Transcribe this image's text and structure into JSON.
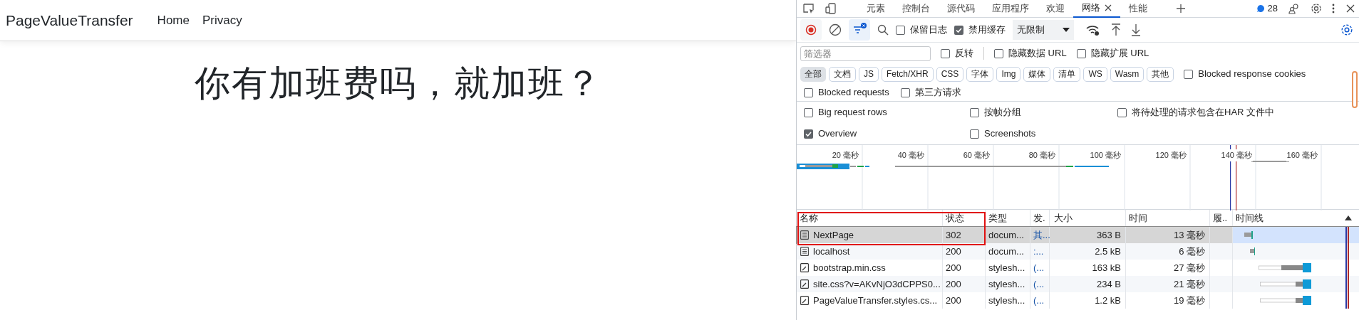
{
  "page": {
    "brand": "PageValueTransfer",
    "nav": [
      "Home",
      "Privacy"
    ],
    "heading": "你有加班费吗，就加班？"
  },
  "devtools": {
    "tabs": [
      {
        "label": "元素",
        "selected": false
      },
      {
        "label": "控制台",
        "selected": false
      },
      {
        "label": "源代码",
        "selected": false
      },
      {
        "label": "应用程序",
        "selected": false
      },
      {
        "label": "欢迎",
        "selected": false
      },
      {
        "label": "网络",
        "selected": true
      },
      {
        "label": "性能",
        "selected": false
      }
    ],
    "issues_count": "28",
    "toolbar": {
      "recording": true,
      "preserve_log": {
        "label": "保留日志",
        "checked": false
      },
      "disable_cache": {
        "label": "禁用缓存",
        "checked": true
      },
      "throttling": "无限制"
    },
    "filter": {
      "placeholder": "筛选器"
    },
    "options": [
      {
        "label": "反转",
        "checked": false
      },
      {
        "label": "隐藏数据 URL",
        "checked": false
      },
      {
        "label": "隐藏扩展 URL",
        "checked": false
      }
    ],
    "type_filters": [
      {
        "label": "全部",
        "selected": true
      },
      {
        "label": "文档",
        "selected": false
      },
      {
        "label": "JS",
        "selected": false
      },
      {
        "label": "Fetch/XHR",
        "selected": false
      },
      {
        "label": "CSS",
        "selected": false
      },
      {
        "label": "字体",
        "selected": false
      },
      {
        "label": "Img",
        "selected": false
      },
      {
        "label": "媒体",
        "selected": false
      },
      {
        "label": "清单",
        "selected": false
      },
      {
        "label": "WS",
        "selected": false
      },
      {
        "label": "Wasm",
        "selected": false
      },
      {
        "label": "其他",
        "selected": false
      }
    ],
    "blocked_response_cookies": {
      "label": "Blocked response cookies",
      "checked": false
    },
    "more_options": [
      {
        "label": "Blocked requests",
        "checked": false
      },
      {
        "label": "第三方请求",
        "checked": false
      }
    ],
    "settings": [
      {
        "label": "Big request rows",
        "checked": false
      },
      {
        "label": "按帧分组",
        "checked": false
      },
      {
        "label": "将待处理的请求包含在HAR 文件中",
        "checked": false
      },
      {
        "label": "Overview",
        "checked": true
      },
      {
        "label": "Screenshots",
        "checked": false
      }
    ],
    "overview": {
      "ticks": [
        "20 毫秒",
        "40 毫秒",
        "60 毫秒",
        "80 毫秒",
        "100 毫秒",
        "120 毫秒",
        "140 毫秒",
        "160 毫秒"
      ]
    },
    "table": {
      "columns": [
        "名称",
        "状态",
        "类型",
        "发.",
        "大小",
        "时间",
        "履..",
        "时间线"
      ],
      "rows": [
        {
          "kind": "document",
          "name": "NextPage",
          "status": "302",
          "type": "docum...",
          "initiator": "其...",
          "size": "363 B",
          "time": "13 毫秒",
          "selected": true
        },
        {
          "kind": "document",
          "name": "localhost",
          "status": "200",
          "type": "docum...",
          "initiator": ":...",
          "size": "2.5 kB",
          "time": "6 毫秒",
          "selected": false
        },
        {
          "kind": "stylesheet",
          "name": "bootstrap.min.css",
          "status": "200",
          "type": "stylesh...",
          "initiator": "(...",
          "size": "163 kB",
          "time": "27 毫秒",
          "selected": false
        },
        {
          "kind": "stylesheet",
          "name": "site.css?v=AKvNjO3dCPPS0...",
          "status": "200",
          "type": "stylesh...",
          "initiator": "(...",
          "size": "234 B",
          "time": "21 毫秒",
          "selected": false
        },
        {
          "kind": "stylesheet",
          "name": "PageValueTransfer.styles.cs...",
          "status": "200",
          "type": "stylesh...",
          "initiator": "(...",
          "size": "1.2 kB",
          "time": "19 毫秒",
          "selected": false
        }
      ]
    }
  }
}
